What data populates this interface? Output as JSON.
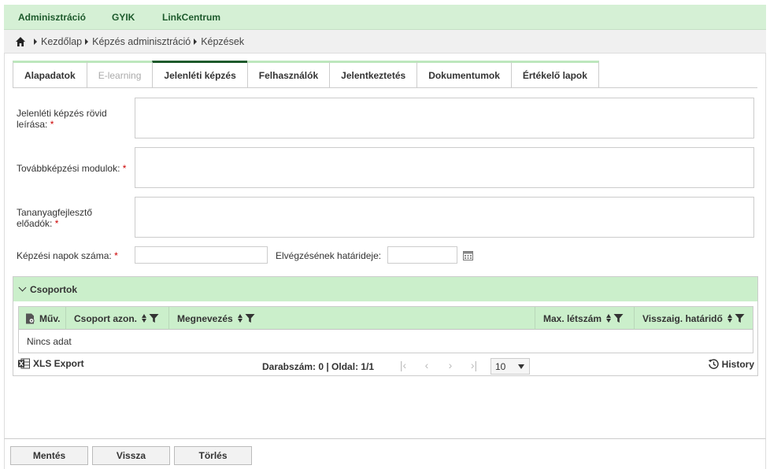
{
  "topnav": {
    "items": [
      {
        "label": "Adminisztráció"
      },
      {
        "label": "GYIK"
      },
      {
        "label": "LinkCentrum"
      }
    ]
  },
  "breadcrumb": {
    "items": [
      "Kezdőlap",
      "Képzés adminisztráció",
      "Képzések"
    ]
  },
  "tabs": [
    {
      "label": "Alapadatok",
      "state": "normal"
    },
    {
      "label": "E-learning",
      "state": "disabled"
    },
    {
      "label": "Jelenléti képzés",
      "state": "active"
    },
    {
      "label": "Felhasználók",
      "state": "normal"
    },
    {
      "label": "Jelentkeztetés",
      "state": "normal"
    },
    {
      "label": "Dokumentumok",
      "state": "normal"
    },
    {
      "label": "Értékelő lapok",
      "state": "normal"
    }
  ],
  "form": {
    "short_desc_label_1": "Jelenléti képzés rövid",
    "short_desc_label_2": "leírása:",
    "modules_label": "Továbbképzési modulok:",
    "presenters_label_1": "Tananyagfejlesztő",
    "presenters_label_2": "előadók:",
    "days_label": "Képzési napok száma:",
    "deadline_label": "Elvégzésének határideje:",
    "required_mark": "*",
    "short_desc_value": "",
    "modules_value": "",
    "presenters_value": "",
    "days_value": "",
    "deadline_value": ""
  },
  "groups": {
    "title": "Csoportok",
    "columns": [
      "Műv.",
      "Csoport azon.",
      "Megnevezés",
      "Max. létszám",
      "Visszaig. határidő"
    ],
    "empty_text": "Nincs adat",
    "export_label": "XLS Export",
    "count_text": "Darabszám: 0 | Oldal: 1/1",
    "page_size": "10",
    "history_label": "History"
  },
  "actions": {
    "save": "Mentés",
    "back": "Vissza",
    "delete": "Törlés"
  },
  "colors": {
    "accent_green": "#cbefcb",
    "dark_green": "#1e5a2c",
    "required": "#cc0000"
  }
}
